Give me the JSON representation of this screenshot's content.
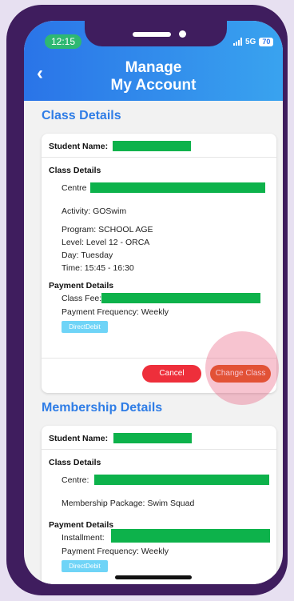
{
  "status_bar": {
    "time": "12:15",
    "network": "5G",
    "battery": "70"
  },
  "header": {
    "title_line1": "Manage",
    "title_line2": "My Account"
  },
  "class_section": {
    "label": "Class Details",
    "student_name_label": "Student Name:",
    "class_details_label": "Class Details",
    "centre_label": "Centre",
    "activity": "Activity: GOSwim",
    "program": "Program: SCHOOL AGE",
    "level": "Level: Level 12 - ORCA",
    "day": "Day: Tuesday",
    "time": "Time: 15:45 - 16:30",
    "payment_details_label": "Payment Details",
    "class_fee_label": "Class Fee:",
    "payment_frequency": "Payment Frequency: Weekly",
    "payment_method_badge": "DirectDebit",
    "cancel_label": "Cancel",
    "change_class_label": "Change Class"
  },
  "membership_section": {
    "label": "Membership Details",
    "student_name_label": "Student Name:",
    "class_details_label": "Class Details",
    "centre_label": "Centre:",
    "membership_package": "Membership Package: Swim Squad",
    "payment_details_label": "Payment Details",
    "installment_label": "Installment:",
    "payment_frequency": "Payment Frequency: Weekly",
    "payment_method_badge": "DirectDebit"
  },
  "colors": {
    "header_gradient_start": "#2a74e8",
    "header_gradient_end": "#39a3ef",
    "section_label": "#2f7de6",
    "redaction": "#0db24b",
    "cancel_button": "#ee2f3b",
    "change_class_button": "#e0581c",
    "badge": "#6fd4f7",
    "phone_frame": "#3f1d5e"
  },
  "icons": {
    "back": "chevron-left-icon"
  }
}
